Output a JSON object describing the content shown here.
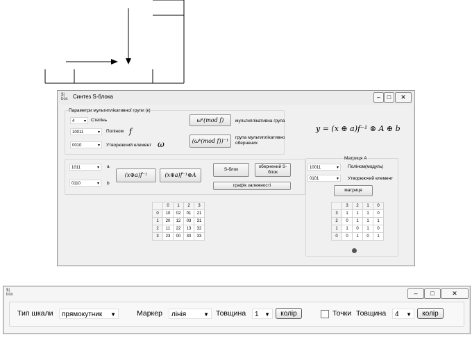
{
  "window": {
    "title": "Синтез S-блока",
    "app_icon": "$-box-icon",
    "app_icon_lines": [
      "$|",
      "box"
    ]
  },
  "params": {
    "group_label": "Параметри мультиплікативної групи (к)",
    "degree_value": "4",
    "degree_label": "Степінь",
    "poly_value": "10011",
    "poly_label": "Поліном",
    "poly_symbol": "f",
    "gen_value": "0010",
    "gen_label": "Утворюючий елемент",
    "gen_symbol": "ω",
    "btn_mult_formula": "ωᵏ(mod f)",
    "mult_group_label": "мультиплікативна група",
    "btn_inv_formula": "(ωᵏ(mod f))⁻¹",
    "inv_group_label": "група мультиплікативно обернених"
  },
  "main_formula": "y = (x ⊕ a)f⁻¹ ⊗ A ⊕ b",
  "inputs": {
    "a_value": "1011",
    "a_label": "a",
    "b_value": "0110",
    "b_label": "b",
    "btn_xa_inv": "(x⊕a)f⁻¹",
    "btn_xa_inv_A": "(x⊕a)f⁻¹⊗A"
  },
  "actions": {
    "sblock": "S-блок",
    "inverse_sblock": "обернений S-блок",
    "dependency_chart": "графік залежності"
  },
  "sblock_table": {
    "headers": [
      "",
      "0",
      "1",
      "2",
      "3"
    ],
    "rows": [
      [
        "0",
        "10",
        "02",
        "01",
        "21"
      ],
      [
        "1",
        "20",
        "12",
        "03",
        "31"
      ],
      [
        "2",
        "11",
        "22",
        "13",
        "32"
      ],
      [
        "3",
        "23",
        "00",
        "30",
        "33"
      ]
    ]
  },
  "matrix": {
    "group_label": "Матриця А",
    "poly_value": "10011",
    "poly_label": "Поліном(модуль)",
    "gen_value": "0101",
    "gen_label": "Утворюючий елемент",
    "matrix_button": "матриця",
    "headers": [
      "",
      "3",
      "2",
      "1",
      "0"
    ],
    "rows": [
      [
        "3",
        "1",
        "1",
        "1",
        "0"
      ],
      [
        "2",
        "0",
        "1",
        "1",
        "1"
      ],
      [
        "1",
        "1",
        "0",
        "1",
        "0"
      ],
      [
        "0",
        "0",
        "1",
        "0",
        "1"
      ]
    ]
  },
  "toolbar": {
    "scale_label": "Тип шкали",
    "scale_value": "прямокутник",
    "marker_label": "Маркер",
    "marker_value": "лінія",
    "thickness_label": "Товщина",
    "thickness_value": "1",
    "color_button": "колір",
    "points_label": "Точки",
    "points_checked": false,
    "thickness2_label": "Товщина",
    "thickness2_value": "4",
    "color2_button": "колір"
  }
}
